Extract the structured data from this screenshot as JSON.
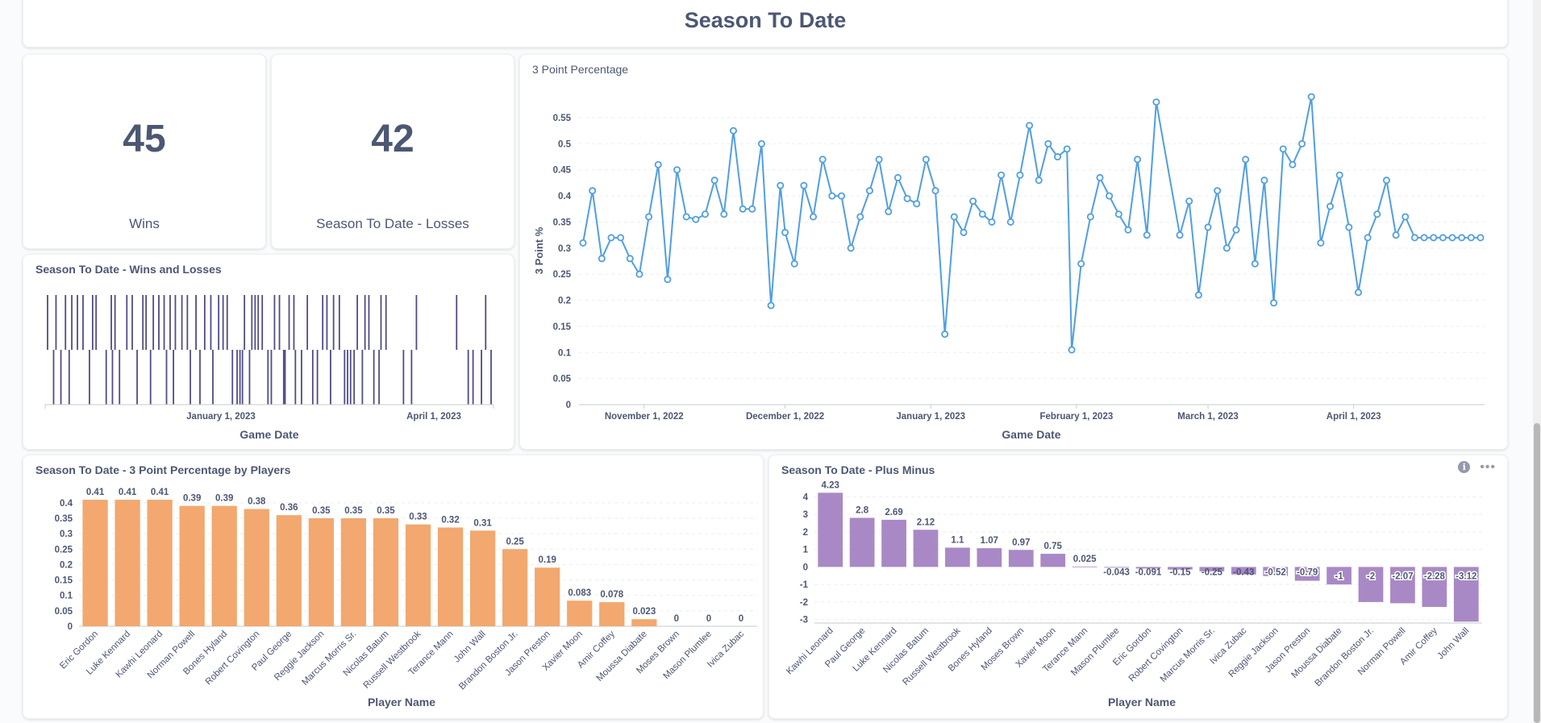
{
  "dashboard": {
    "title": "Season To Date"
  },
  "wins": {
    "value": "45",
    "label": "Wins"
  },
  "losses": {
    "value": "42",
    "label": "Season To Date - Losses"
  },
  "wl_chart": {
    "title": "Season To Date - Wins and Losses",
    "xlabel": "Game Date",
    "tick_labels": [
      "January 1, 2023",
      "April 1, 2023"
    ]
  },
  "chart_data": [
    {
      "type": "bar",
      "title": "Season To Date - Wins and Losses",
      "xlabel": "Game Date",
      "note": "win/loss strip per game",
      "x_ticks": [
        "January 1, 2023",
        "April 1, 2023"
      ],
      "games": [
        {
          "x": 0,
          "r": "W"
        },
        {
          "x": 0.0136,
          "r": "L"
        },
        {
          "x": 0.019,
          "r": "W"
        },
        {
          "x": 0.0301,
          "r": "L"
        },
        {
          "x": 0.0404,
          "r": "W"
        },
        {
          "x": 0.0487,
          "r": "L"
        },
        {
          "x": 0.0546,
          "r": "W"
        },
        {
          "x": 0.0673,
          "r": "W"
        },
        {
          "x": 0.0799,
          "r": "W"
        },
        {
          "x": 0.0944,
          "r": "L"
        },
        {
          "x": 0.1016,
          "r": "W"
        },
        {
          "x": 0.1094,
          "r": "W"
        },
        {
          "x": 0.1322,
          "r": "L"
        },
        {
          "x": 0.1437,
          "r": "W"
        },
        {
          "x": 0.1463,
          "r": "L"
        },
        {
          "x": 0.1521,
          "r": "W"
        },
        {
          "x": 0.1622,
          "r": "L"
        },
        {
          "x": 0.1787,
          "r": "W"
        },
        {
          "x": 0.1909,
          "r": "W"
        },
        {
          "x": 0.2019,
          "r": "L"
        },
        {
          "x": 0.2149,
          "r": "W"
        },
        {
          "x": 0.2221,
          "r": "W"
        },
        {
          "x": 0.2322,
          "r": "L"
        },
        {
          "x": 0.2384,
          "r": "W"
        },
        {
          "x": 0.2509,
          "r": "W"
        },
        {
          "x": 0.2628,
          "r": "W"
        },
        {
          "x": 0.2682,
          "r": "L"
        },
        {
          "x": 0.2763,
          "r": "W"
        },
        {
          "x": 0.2838,
          "r": "L"
        },
        {
          "x": 0.2881,
          "r": "W"
        },
        {
          "x": 0.3029,
          "r": "W"
        },
        {
          "x": 0.3152,
          "r": "W"
        },
        {
          "x": 0.3219,
          "r": "L"
        },
        {
          "x": 0.3347,
          "r": "W"
        },
        {
          "x": 0.3436,
          "r": "L"
        },
        {
          "x": 0.3543,
          "r": "W"
        },
        {
          "x": 0.3681,
          "r": "W"
        },
        {
          "x": 0.3727,
          "r": "L"
        },
        {
          "x": 0.3857,
          "r": "W"
        },
        {
          "x": 0.3957,
          "r": "W"
        },
        {
          "x": 0.405,
          "r": "W"
        },
        {
          "x": 0.4168,
          "r": "L"
        },
        {
          "x": 0.4274,
          "r": "L"
        },
        {
          "x": 0.4338,
          "r": "L"
        },
        {
          "x": 0.4394,
          "r": "L"
        },
        {
          "x": 0.4439,
          "r": "W"
        },
        {
          "x": 0.4554,
          "r": "L"
        },
        {
          "x": 0.4606,
          "r": "W"
        },
        {
          "x": 0.4679,
          "r": "W"
        },
        {
          "x": 0.4749,
          "r": "W"
        },
        {
          "x": 0.484,
          "r": "W"
        },
        {
          "x": 0.4969,
          "r": "L"
        },
        {
          "x": 0.5045,
          "r": "L"
        },
        {
          "x": 0.5117,
          "r": "W"
        },
        {
          "x": 0.5228,
          "r": "W"
        },
        {
          "x": 0.5324,
          "r": "L"
        },
        {
          "x": 0.5355,
          "r": "L"
        },
        {
          "x": 0.5446,
          "r": "W"
        },
        {
          "x": 0.5554,
          "r": "W"
        },
        {
          "x": 0.5588,
          "r": "L"
        },
        {
          "x": 0.5726,
          "r": "L"
        },
        {
          "x": 0.5857,
          "r": "W"
        },
        {
          "x": 0.5979,
          "r": "L"
        },
        {
          "x": 0.6084,
          "r": "L"
        },
        {
          "x": 0.6203,
          "r": "W"
        },
        {
          "x": 0.6299,
          "r": "W"
        },
        {
          "x": 0.6381,
          "r": "L"
        },
        {
          "x": 0.6448,
          "r": "W"
        },
        {
          "x": 0.6579,
          "r": "W"
        },
        {
          "x": 0.6697,
          "r": "L"
        },
        {
          "x": 0.6764,
          "r": "L"
        },
        {
          "x": 0.6832,
          "r": "L"
        },
        {
          "x": 0.6912,
          "r": "L"
        },
        {
          "x": 0.6983,
          "r": "W"
        },
        {
          "x": 0.7098,
          "r": "L"
        },
        {
          "x": 0.7157,
          "r": "W"
        },
        {
          "x": 0.7245,
          "r": "W"
        },
        {
          "x": 0.7357,
          "r": "L"
        },
        {
          "x": 0.7474,
          "r": "L"
        },
        {
          "x": 0.7518,
          "r": "W"
        },
        {
          "x": 0.7631,
          "r": "W"
        },
        {
          "x": 0.8025,
          "r": "L"
        },
        {
          "x": 0.8207,
          "r": "L"
        },
        {
          "x": 0.8317,
          "r": "W"
        },
        {
          "x": 0.9223,
          "r": "W"
        },
        {
          "x": 0.9485,
          "r": "L"
        },
        {
          "x": 0.9593,
          "r": "L"
        },
        {
          "x": 0.9783,
          "r": "L"
        },
        {
          "x": 0.9878,
          "r": "W"
        },
        {
          "x": 1,
          "r": "L"
        }
      ]
    },
    {
      "type": "line",
      "title": "3 Point Percentage",
      "xlabel": "Game Date",
      "ylabel": "3 Point %",
      "ylim": [
        0,
        0.55
      ],
      "y_ticks": [
        0,
        0.05,
        0.1,
        0.15,
        0.2,
        0.25,
        0.3,
        0.35,
        0.4,
        0.45,
        0.5,
        0.55
      ],
      "x_ticks": [
        "November 1, 2022",
        "December 1, 2022",
        "January 1, 2023",
        "February 1, 2023",
        "March 1, 2023",
        "April 1, 2023"
      ],
      "grid": true,
      "series": [
        {
          "x": [
            "2022-10-19",
            "2022-10-21",
            "2022-10-23",
            "2022-10-25",
            "2022-10-27",
            "2022-10-29",
            "2022-10-31",
            "2022-11-02",
            "2022-11-04",
            "2022-11-06",
            "2022-11-08",
            "2022-11-10",
            "2022-11-12",
            "2022-11-14",
            "2022-11-16",
            "2022-11-18",
            "2022-11-20",
            "2022-11-22",
            "2022-11-24",
            "2022-11-26",
            "2022-11-28",
            "2022-11-30",
            "2022-12-01",
            "2022-12-03",
            "2022-12-05",
            "2022-12-07",
            "2022-12-09",
            "2022-12-11",
            "2022-12-13",
            "2022-12-15",
            "2022-12-17",
            "2022-12-19",
            "2022-12-21",
            "2022-12-23",
            "2022-12-25",
            "2022-12-27",
            "2022-12-29",
            "2022-12-31",
            "2023-01-02",
            "2023-01-04",
            "2023-01-06",
            "2023-01-08",
            "2023-01-10",
            "2023-01-12",
            "2023-01-14",
            "2023-01-16",
            "2023-01-18",
            "2023-01-20",
            "2023-01-22",
            "2023-01-24",
            "2023-01-26",
            "2023-01-28",
            "2023-01-30",
            "2023-01-31",
            "2023-02-02",
            "2023-02-04",
            "2023-02-06",
            "2023-02-08",
            "2023-02-10",
            "2023-02-12",
            "2023-02-14",
            "2023-02-16",
            "2023-02-18",
            "2023-02-23",
            "2023-02-25",
            "2023-02-27",
            "2023-03-01",
            "2023-03-03",
            "2023-03-05",
            "2023-03-07",
            "2023-03-09",
            "2023-03-11",
            "2023-03-13",
            "2023-03-15",
            "2023-03-17",
            "2023-03-19",
            "2023-03-21",
            "2023-03-23",
            "2023-03-25",
            "2023-03-27",
            "2023-03-29",
            "2023-03-31",
            "2023-04-02",
            "2023-04-04",
            "2023-04-06",
            "2023-04-08",
            "2023-04-10",
            "2023-04-12",
            "2023-04-14",
            "2023-04-16",
            "2023-04-18",
            "2023-04-20",
            "2023-04-22",
            "2023-04-24",
            "2023-04-26",
            "2023-04-28"
          ],
          "values": [
            0.31,
            0.41,
            0.28,
            0.32,
            0.32,
            0.28,
            0.25,
            0.36,
            0.46,
            0.24,
            0.45,
            0.36,
            0.355,
            0.365,
            0.43,
            0.365,
            0.525,
            0.375,
            0.375,
            0.5,
            0.19,
            0.42,
            0.33,
            0.27,
            0.42,
            0.36,
            0.47,
            0.4,
            0.4,
            0.3,
            0.36,
            0.41,
            0.47,
            0.37,
            0.435,
            0.395,
            0.385,
            0.47,
            0.41,
            0.135,
            0.36,
            0.33,
            0.39,
            0.365,
            0.35,
            0.44,
            0.35,
            0.44,
            0.535,
            0.43,
            0.5,
            0.475,
            0.49,
            0.105,
            0.27,
            0.36,
            0.435,
            0.4,
            0.365,
            0.335,
            0.47,
            0.325,
            0.58,
            0.325,
            0.39,
            0.21,
            0.34,
            0.41,
            0.3,
            0.335,
            0.47,
            0.27,
            0.43,
            0.195,
            0.49,
            0.46,
            0.5,
            0.59,
            0.31,
            0.38,
            0.44,
            0.34,
            0.215,
            0.32,
            0.365,
            0.43,
            0.325,
            0.36,
            0.32,
            0.32,
            0.32,
            0.32,
            0.32,
            0.32,
            0.32,
            0.32
          ]
        }
      ]
    },
    {
      "type": "bar",
      "title": "Season To Date - 3 Point Percentage by Players",
      "xlabel": "Player Name",
      "ylim": [
        0,
        0.4
      ],
      "y_ticks": [
        0,
        0.05,
        0.1,
        0.15,
        0.2,
        0.25,
        0.3,
        0.35,
        0.4
      ],
      "color": "#f2a86f",
      "categories": [
        "Eric Gordon",
        "Luke Kennard",
        "Kawhi Leonard",
        "Norman Powell",
        "Bones Hyland",
        "Robert Covington",
        "Paul George",
        "Reggie Jackson",
        "Marcus Morris Sr.",
        "Nicolas Batum",
        "Russell Westbrook",
        "Terance Mann",
        "John Wall",
        "Brandon Boston Jr.",
        "Jason Preston",
        "Xavier Moon",
        "Amir Coffey",
        "Moussa Diabate",
        "Moses Brown",
        "Mason Plumlee",
        "Ivica Zubac"
      ],
      "values": [
        0.41,
        0.41,
        0.41,
        0.39,
        0.39,
        0.38,
        0.36,
        0.35,
        0.35,
        0.35,
        0.33,
        0.32,
        0.31,
        0.25,
        0.19,
        0.083,
        0.078,
        0.023,
        0,
        0,
        0
      ],
      "labels": [
        "0.41",
        "0.41",
        "0.41",
        "0.39",
        "0.39",
        "0.38",
        "0.36",
        "0.35",
        "0.35",
        "0.35",
        "0.33",
        "0.32",
        "0.31",
        "0.25",
        "0.19",
        "0.083",
        "0.078",
        "0.023",
        "0",
        "0",
        "0"
      ]
    },
    {
      "type": "bar",
      "title": "Season To Date - Plus Minus",
      "xlabel": "Player Name",
      "ylim": [
        -3,
        4
      ],
      "y_ticks": [
        -3,
        -2,
        -1,
        0,
        1,
        2,
        3,
        4
      ],
      "color": "#a989c5",
      "categories": [
        "Kawhi Leonard",
        "Paul George",
        "Luke Kennard",
        "Nicolas Batum",
        "Russell Westbrook",
        "Bones Hyland",
        "Moses Brown",
        "Xavier Moon",
        "Terance Mann",
        "Mason Plumlee",
        "Eric Gordon",
        "Robert Covington",
        "Marcus Morris Sr.",
        "Ivica Zubac",
        "Reggie Jackson",
        "Jason Preston",
        "Moussa Diabate",
        "Brandon Boston Jr.",
        "Norman Powell",
        "Amir Coffey",
        "John Wall"
      ],
      "values": [
        4.23,
        2.8,
        2.69,
        2.12,
        1.1,
        1.07,
        0.97,
        0.75,
        0.025,
        -0.043,
        -0.091,
        -0.15,
        -0.25,
        -0.43,
        -0.52,
        -0.79,
        -1,
        -2,
        -2.07,
        -2.28,
        -3.12
      ],
      "labels": [
        "4.23",
        "2.8",
        "2.69",
        "2.12",
        "1.1",
        "1.07",
        "0.97",
        "0.75",
        "0.025",
        "-0.043",
        "-0.091",
        "-0.15",
        "-0.25",
        "-0.43",
        "-0.52",
        "-0.79",
        "-1",
        "-2",
        "-2.07",
        "-2.28",
        "-3.12"
      ]
    }
  ],
  "colors": {
    "accent": "#509ee3",
    "wl_bar": "#4f4c85",
    "orange": "#f2a86f",
    "purple": "#a989c5",
    "text": "#4c5773"
  },
  "icons": {
    "info": "info-icon",
    "more": "more-icon"
  }
}
